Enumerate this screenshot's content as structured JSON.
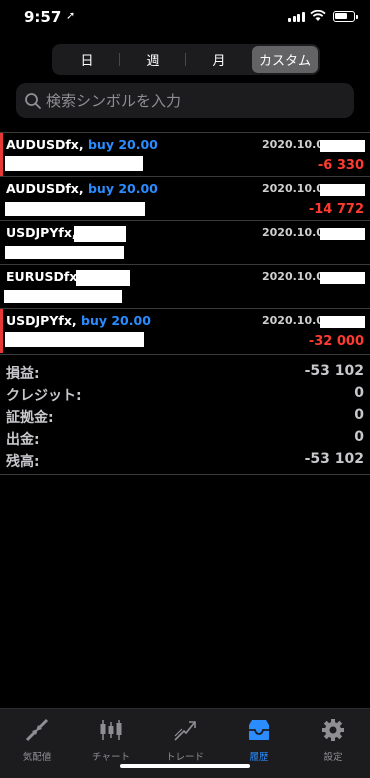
{
  "status_bar": {
    "time": "9:57"
  },
  "segments": [
    {
      "label": "日"
    },
    {
      "label": "週"
    },
    {
      "label": "月"
    },
    {
      "label": "カスタム"
    }
  ],
  "search": {
    "placeholder": "検索シンボルを入力"
  },
  "trades": [
    {
      "symbol": "AUDUSDfx,",
      "action": "buy 20.00",
      "date": "2020.10.01",
      "pnl": "-6 330"
    },
    {
      "symbol": "AUDUSDfx,",
      "action": "buy 20.00",
      "date": "2020.10.01",
      "pnl": "-14 772"
    },
    {
      "symbol": "USDJPYfx,",
      "action": "",
      "date": "2020.10.01",
      "pnl": ""
    },
    {
      "symbol": "EURUSDfx,",
      "action": "",
      "date": "2020.10.01",
      "pnl": ""
    },
    {
      "symbol": "USDJPYfx,",
      "action": "buy 20.00",
      "date": "2020.10.01",
      "pnl": "-32 000"
    }
  ],
  "summary": [
    {
      "label": "損益:",
      "value": "-53 102"
    },
    {
      "label": "クレジット:",
      "value": "0"
    },
    {
      "label": "証拠金:",
      "value": "0"
    },
    {
      "label": "出金:",
      "value": "0"
    },
    {
      "label": "残高:",
      "value": "-53 102"
    }
  ],
  "tabbar": [
    {
      "label": "気配値",
      "icon": "quotes-icon"
    },
    {
      "label": "チャート",
      "icon": "chart-icon"
    },
    {
      "label": "トレード",
      "icon": "trade-icon"
    },
    {
      "label": "履歴",
      "icon": "history-icon"
    },
    {
      "label": "設定",
      "icon": "settings-icon"
    }
  ],
  "colors": {
    "accent": "#2a8cff",
    "loss": "#ff3b30",
    "marker": "#e53935"
  }
}
